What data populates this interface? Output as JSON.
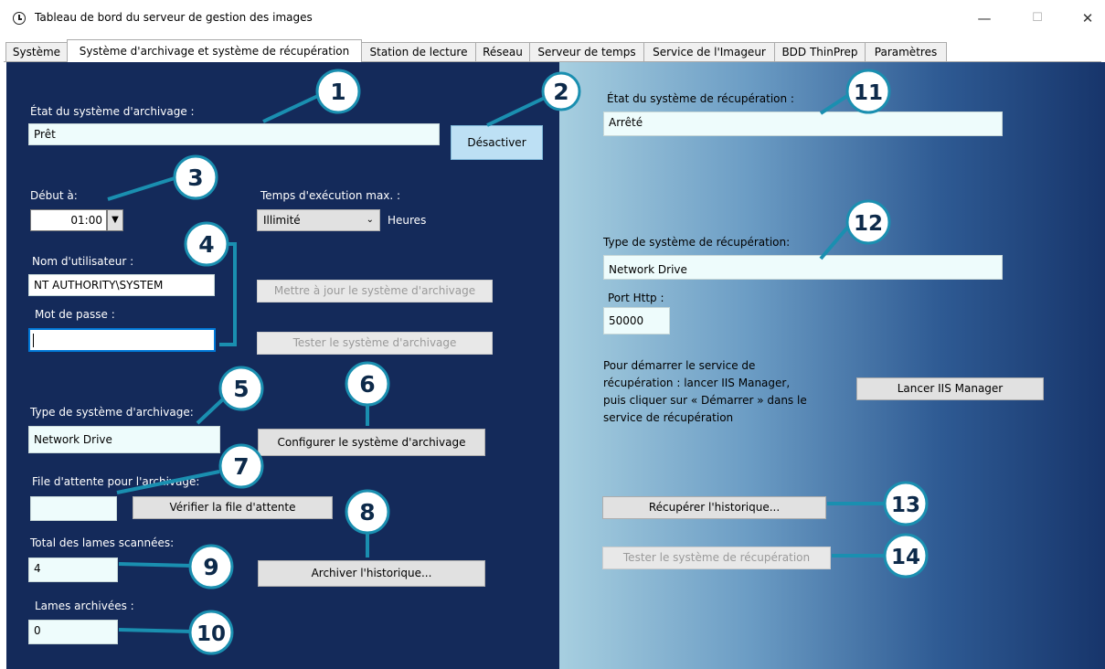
{
  "window": {
    "title": "Tableau de bord du serveur de gestion des images",
    "minimize": "—",
    "maximize": "☐",
    "close": "✕"
  },
  "tabs": [
    {
      "label": "Système"
    },
    {
      "label": "Système d'archivage et système de récupération"
    },
    {
      "label": "Station de lecture"
    },
    {
      "label": "Réseau"
    },
    {
      "label": "Serveur de temps"
    },
    {
      "label": "Service de l'Imageur"
    },
    {
      "label": "BDD ThinPrep"
    },
    {
      "label": "Paramètres"
    }
  ],
  "archive": {
    "status_label": "État du système d'archivage :",
    "status_value": "Prêt",
    "deactivate_button": "Désactiver",
    "start_label": "Début à:",
    "start_value": "01:00",
    "max_runtime_label": "Temps d'exécution max. :",
    "max_runtime_value": "Illimité",
    "hours_label": "Heures",
    "username_label": "Nom d'utilisateur :",
    "username_value": "NT AUTHORITY\\SYSTEM",
    "password_label": "Mot de passe :",
    "password_value": "",
    "update_button": "Mettre à jour le système d'archivage",
    "test_button": "Tester le système d'archivage",
    "type_label": "Type de système d'archivage:",
    "type_value": "Network Drive",
    "configure_button": "Configurer le système d'archivage",
    "queue_label": "File d'attente  pour l'archivage:",
    "queue_value": "",
    "check_queue_button": "Vérifier la file d'attente",
    "total_scanned_label": "Total des lames scannées:",
    "total_scanned_value": "4",
    "archive_history_button": "Archiver l'historique...",
    "archived_label": "Lames archivées :",
    "archived_value": "0"
  },
  "retrieval": {
    "status_label": "État du système de récupération :",
    "status_value": "Arrêté",
    "type_label": "Type de système de récupération:",
    "type_value": "Network Drive",
    "port_label": "Port Http :",
    "port_value": "50000",
    "instructions_line1": "Pour démarrer le service de",
    "instructions_line2": "récupération : lancer IIS Manager,",
    "instructions_line3": "puis cliquer sur « Démarrer » dans le",
    "instructions_line4": "service de récupération",
    "launch_iis_button": "Lancer IIS Manager",
    "retrieve_history_button": "Récupérer l'historique...",
    "test_button": "Tester le système de récupération"
  },
  "callouts": [
    "1",
    "2",
    "3",
    "4",
    "5",
    "6",
    "7",
    "8",
    "9",
    "10",
    "11",
    "12",
    "13",
    "14"
  ],
  "colors": {
    "left_panel": "#142a5a",
    "callout_fill": "#ffffff",
    "callout_stroke": "#1a8fb0",
    "field_bg": "#eefcfc"
  }
}
